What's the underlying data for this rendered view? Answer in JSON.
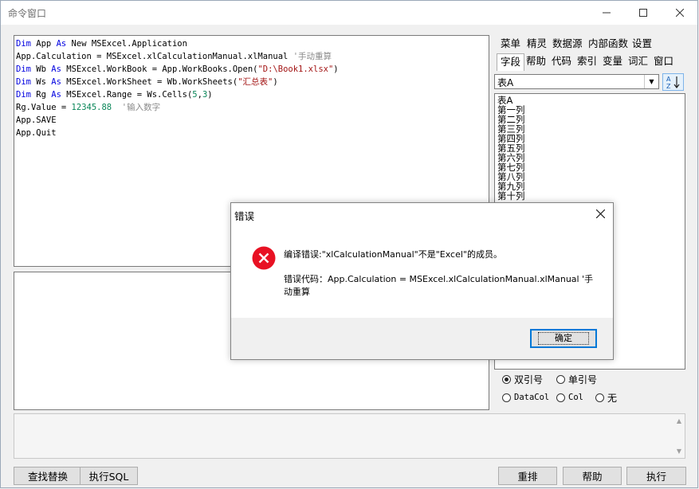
{
  "window": {
    "title": "命令窗口"
  },
  "code_lines": [
    [
      {
        "c": "kw",
        "t": "Dim"
      },
      {
        "c": "pl",
        "t": " App "
      },
      {
        "c": "kw",
        "t": "As"
      },
      {
        "c": "pl",
        "t": " New MSExcel.Application"
      }
    ],
    [
      {
        "c": "pl",
        "t": "App.Calculation = MSExcel.xlCalculationManual.xlManual "
      },
      {
        "c": "cmt",
        "t": "'手动重算"
      }
    ],
    [
      {
        "c": "kw",
        "t": "Dim"
      },
      {
        "c": "pl",
        "t": " Wb "
      },
      {
        "c": "kw",
        "t": "As"
      },
      {
        "c": "pl",
        "t": " MSExcel.WorkBook = App.WorkBooks.Open("
      },
      {
        "c": "str",
        "t": "\"D:\\Book1.xlsx\""
      },
      {
        "c": "pl",
        "t": ")"
      }
    ],
    [
      {
        "c": "kw",
        "t": "Dim"
      },
      {
        "c": "pl",
        "t": " Ws "
      },
      {
        "c": "kw",
        "t": "As"
      },
      {
        "c": "pl",
        "t": " MSExcel.WorkSheet = Wb.WorkSheets("
      },
      {
        "c": "str",
        "t": "\"汇总表\""
      },
      {
        "c": "pl",
        "t": ")"
      }
    ],
    [
      {
        "c": "kw",
        "t": "Dim"
      },
      {
        "c": "pl",
        "t": " Rg "
      },
      {
        "c": "kw",
        "t": "As"
      },
      {
        "c": "pl",
        "t": " MSExcel.Range = Ws.Cells("
      },
      {
        "c": "num",
        "t": "5"
      },
      {
        "c": "pl",
        "t": ","
      },
      {
        "c": "num",
        "t": "3"
      },
      {
        "c": "pl",
        "t": ")"
      }
    ],
    [
      {
        "c": "pl",
        "t": "Rg.Value = "
      },
      {
        "c": "num",
        "t": "12345.88"
      },
      {
        "c": "pl",
        "t": "  "
      },
      {
        "c": "cmt",
        "t": "'输入数字"
      }
    ],
    [
      {
        "c": "pl",
        "t": "App.SAVE"
      }
    ],
    [
      {
        "c": "pl",
        "t": "App.Quit"
      }
    ]
  ],
  "side_tabs_row1": [
    "菜单",
    "精灵",
    "数据源",
    "内部函数",
    "设置"
  ],
  "side_tabs_row2": [
    "字段",
    "帮助",
    "代码",
    "索引",
    "变量",
    "词汇",
    "窗口"
  ],
  "active_tab": "字段",
  "table_select": {
    "value": "表A"
  },
  "fields": [
    "表A",
    "第一列",
    "第二列",
    "第三列",
    "第四列",
    "第五列",
    "第六列",
    "第七列",
    "第八列",
    "第九列",
    "第十列"
  ],
  "quote_options": [
    {
      "label": "双引号",
      "checked": true
    },
    {
      "label": "单引号",
      "checked": false
    }
  ],
  "name_options": [
    {
      "label": "DataCol",
      "checked": true
    },
    {
      "label": "Col",
      "checked": false
    },
    {
      "label": "无",
      "checked": false
    }
  ],
  "buttons": {
    "find_replace": "查找替换",
    "run_sql": "执行SQL",
    "rearrange": "重排",
    "help": "帮助",
    "execute": "执行"
  },
  "dialog": {
    "title": "错误",
    "message": "编译错误:\"xlCalculationManual\"不是\"Excel\"的成员。",
    "code_text": "错误代码：App.Calculation = MSExcel.xlCalculationManual.xlManual '手动重算",
    "ok_label": "确定"
  }
}
